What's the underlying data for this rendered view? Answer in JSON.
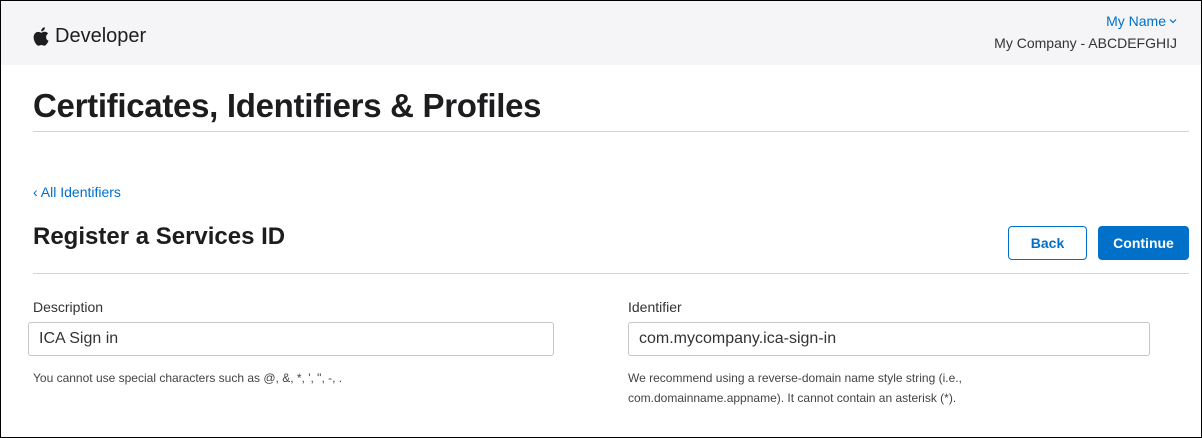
{
  "header": {
    "brand": "Developer",
    "account_name": "My Name",
    "account_team": "My Company - ABCDEFGHIJ"
  },
  "page": {
    "title": "Certificates, Identifiers & Profiles",
    "back_link": "‹ All Identifiers",
    "section_title": "Register a Services ID"
  },
  "actions": {
    "back_label": "Back",
    "continue_label": "Continue",
    "continue_color": "#0070c9"
  },
  "form": {
    "description": {
      "label": "Description",
      "value": "ICA Sign in",
      "hint": "You cannot use special characters such as @, &, *, ', \", -, ."
    },
    "identifier": {
      "label": "Identifier",
      "value": "com.mycompany.ica-sign-in",
      "hint_line1": "We recommend using a reverse-domain name style string (i.e.,",
      "hint_line2": "com.domainname.appname). It cannot contain an asterisk (*)."
    }
  },
  "icons": {
    "brand": "apple-logo-icon",
    "account_menu": "chevron-down-icon"
  }
}
